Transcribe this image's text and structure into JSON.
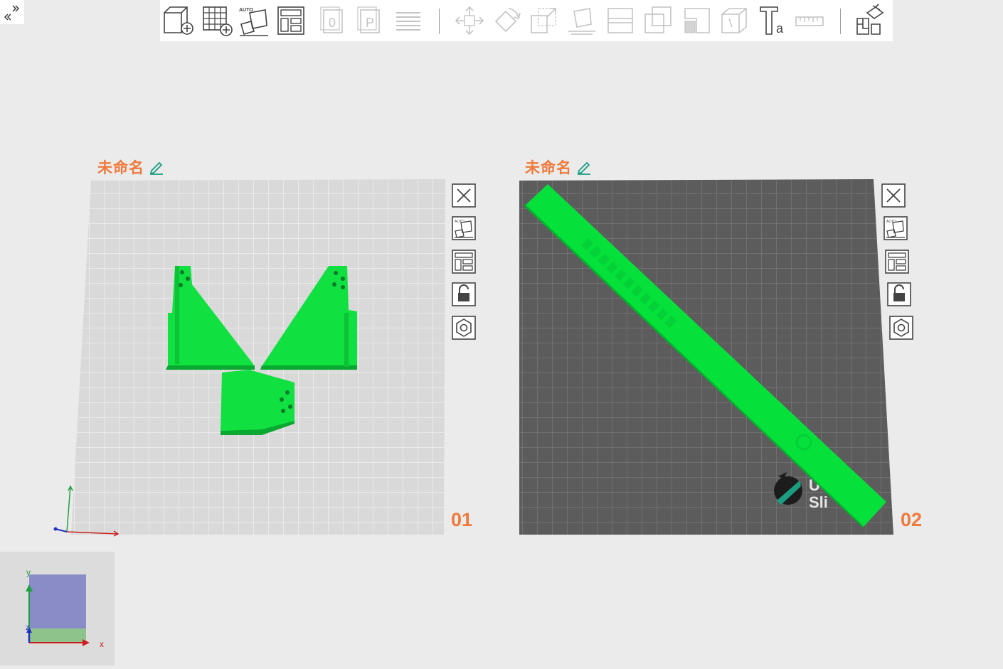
{
  "window": {
    "collapse_icon": "double-chevron-icon"
  },
  "toolbar": {
    "buttons": [
      {
        "name": "add-model",
        "icon": "cube-plus-icon",
        "enabled": true
      },
      {
        "name": "add-plate",
        "icon": "grid-plus-icon",
        "enabled": true
      },
      {
        "name": "auto-orient",
        "icon": "auto-orient-icon",
        "label": "AUTO",
        "enabled": true
      },
      {
        "name": "arrange",
        "icon": "arrange-icon",
        "enabled": true
      },
      {
        "name": "copy",
        "icon": "copy-icon",
        "enabled": false
      },
      {
        "name": "paste",
        "icon": "paste-icon",
        "enabled": false
      },
      {
        "name": "layers",
        "icon": "layers-icon",
        "enabled": false
      },
      {
        "name": "move",
        "icon": "move-icon",
        "enabled": false
      },
      {
        "name": "rotate",
        "icon": "rotate-icon",
        "enabled": false
      },
      {
        "name": "scale",
        "icon": "scale-icon",
        "enabled": false
      },
      {
        "name": "lay-on-face",
        "icon": "lay-face-icon",
        "enabled": false
      },
      {
        "name": "cut",
        "icon": "cut-icon",
        "enabled": false
      },
      {
        "name": "boolean",
        "icon": "boolean-icon",
        "enabled": false
      },
      {
        "name": "support",
        "icon": "support-icon",
        "enabled": false
      },
      {
        "name": "seam",
        "icon": "seam-icon",
        "enabled": false
      },
      {
        "name": "text",
        "icon": "text-icon",
        "enabled": true
      },
      {
        "name": "measure",
        "icon": "ruler-icon",
        "enabled": false
      },
      {
        "name": "assemble",
        "icon": "assemble-icon",
        "enabled": true
      }
    ]
  },
  "plates": [
    {
      "title": "未命名",
      "number": "01",
      "bed_color": "#d9d9d9",
      "grid_color": "#f2f2f2",
      "side_buttons": [
        "close-icon",
        "auto-orient-icon",
        "arrange-icon",
        "lock-icon",
        "settings-icon"
      ]
    },
    {
      "title": "未命名",
      "number": "02",
      "bed_color": "#5c5c5c",
      "grid_color": "#7a7a7a",
      "watermark": "Sli",
      "side_buttons": [
        "close-icon",
        "auto-orient-icon",
        "arrange-icon",
        "lock-icon",
        "settings-icon"
      ]
    }
  ],
  "colors": {
    "model": "#10e040",
    "accent": "#f07a3c",
    "edit_icon": "#1a9e80"
  },
  "axis_widget": {
    "x_label": "x",
    "y_label": "y",
    "z_label": "z"
  }
}
